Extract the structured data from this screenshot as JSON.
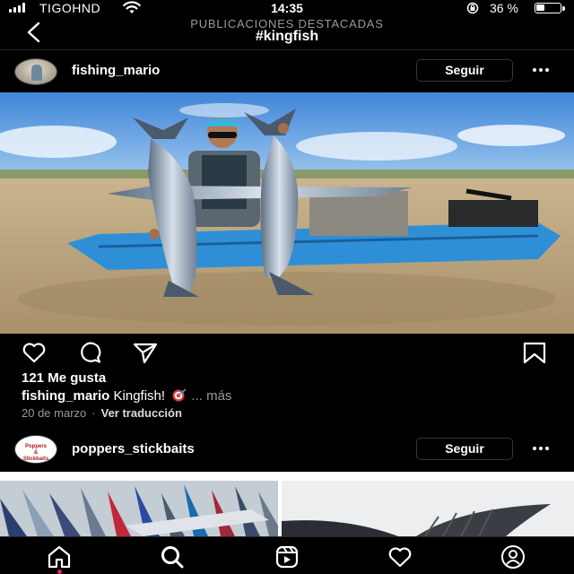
{
  "status_bar": {
    "carrier": "TIGOHND",
    "time": "14:35",
    "battery_percent": "36 %",
    "battery_level": 0.36
  },
  "header": {
    "subtitle": "PUBLICACIONES DESTACADAS",
    "title": "#kingfish"
  },
  "post": {
    "username": "fishing_mario",
    "follow_label": "Seguir",
    "likes": "121 Me gusta",
    "caption_user": "fishing_mario",
    "caption_text": "Kingfish!",
    "caption_more": "... más",
    "date": "20 de marzo",
    "separator": "·",
    "translate_label": "Ver traducción"
  },
  "next_post": {
    "username": "poppers_stickbaits",
    "follow_label": "Seguir",
    "avatar_text_line1": "Poppers",
    "avatar_text_line2": "&",
    "avatar_text_line3": "Stickbaits"
  },
  "icons": {
    "back": "chevron-left-icon",
    "like": "heart-icon",
    "comment": "comment-bubble-icon",
    "share": "paper-plane-icon",
    "save": "bookmark-icon",
    "nav": [
      "home-icon",
      "search-icon",
      "reels-icon",
      "heart-icon",
      "profile-icon"
    ]
  },
  "colors": {
    "background": "#000000",
    "muted_text": "#9a9a9a",
    "button_border": "#363636",
    "notification_dot": "#e0245e"
  }
}
